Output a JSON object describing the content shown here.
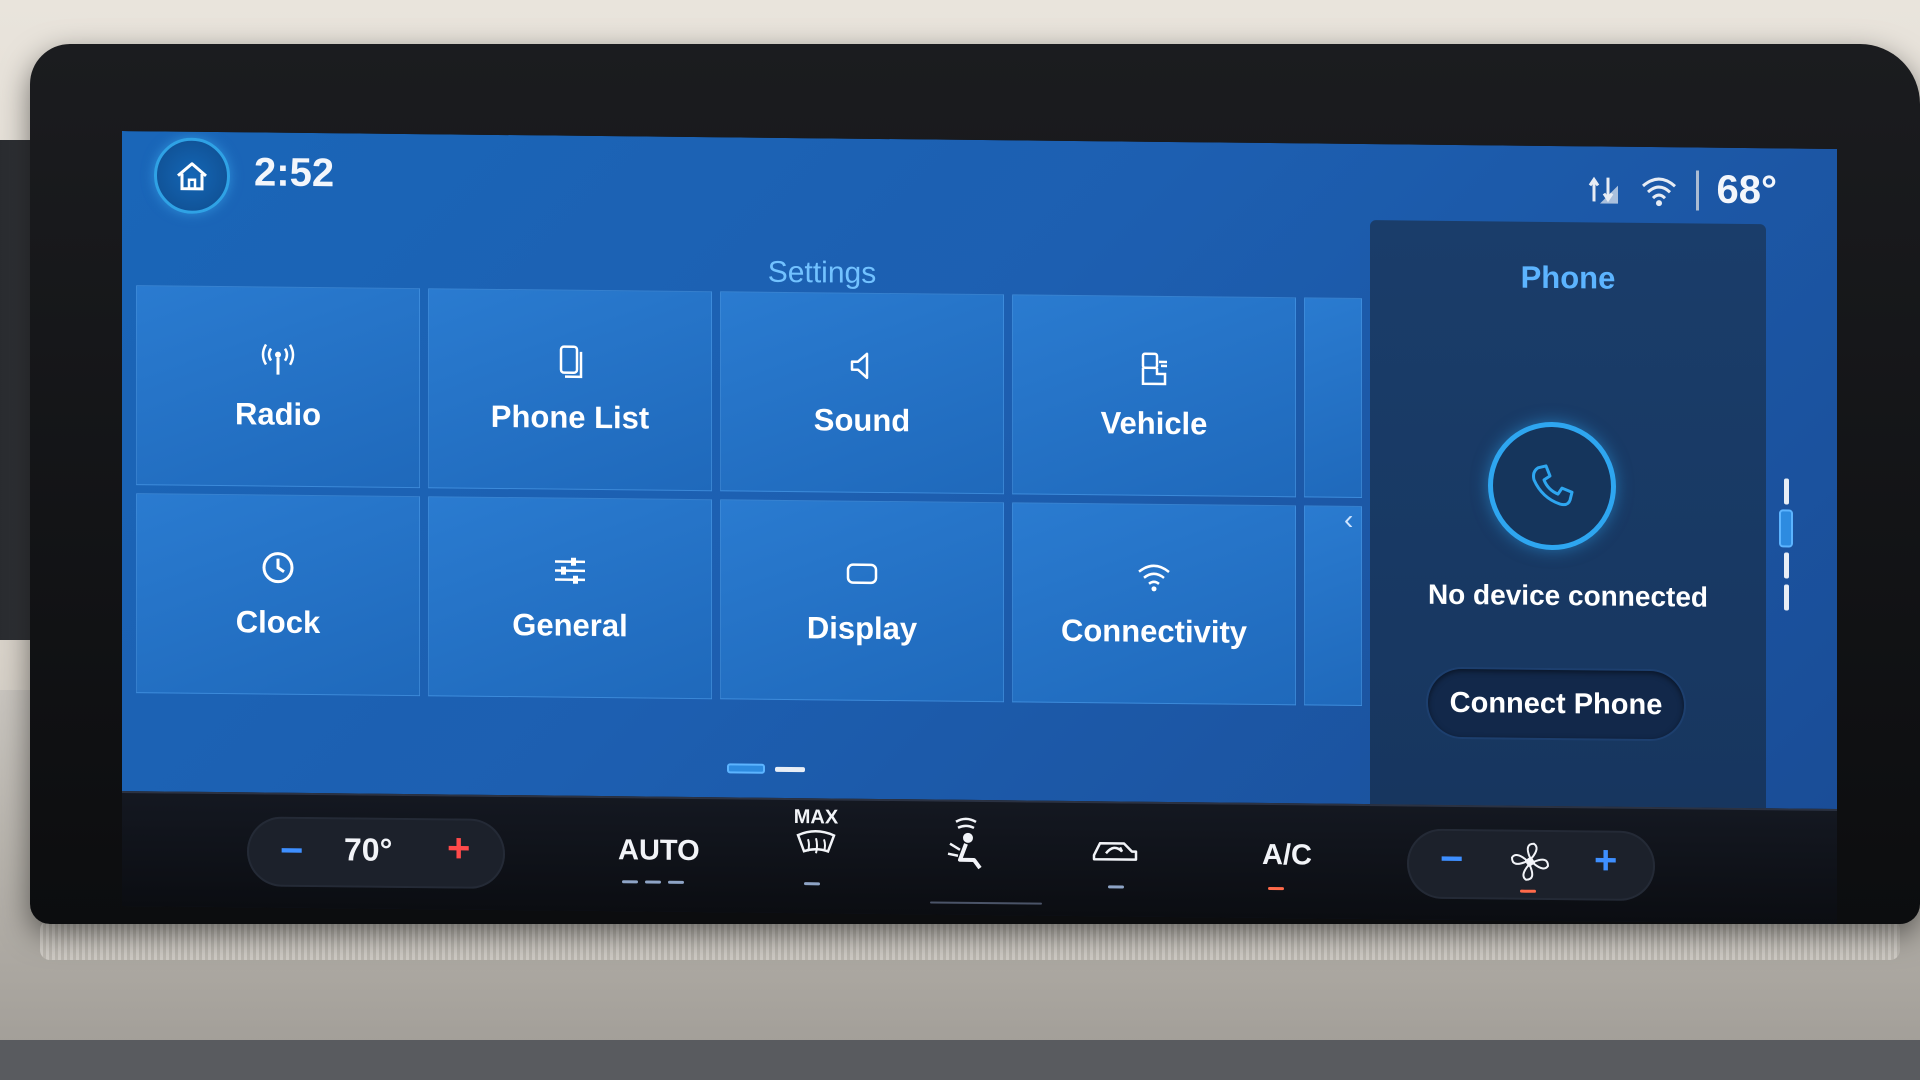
{
  "status_bar": {
    "time": "2:52",
    "outside_temp": "68°"
  },
  "settings": {
    "title": "Settings",
    "tiles": [
      {
        "label": "Radio",
        "icon": "radio-antenna-icon"
      },
      {
        "label": "Phone List",
        "icon": "phone-list-icon"
      },
      {
        "label": "Sound",
        "icon": "speaker-icon"
      },
      {
        "label": "Vehicle",
        "icon": "vehicle-icon"
      },
      {
        "label": "Clock",
        "icon": "clock-icon"
      },
      {
        "label": "General",
        "icon": "sliders-icon"
      },
      {
        "label": "Display",
        "icon": "display-icon"
      },
      {
        "label": "Connectivity",
        "icon": "wifi-icon"
      }
    ]
  },
  "phone_panel": {
    "title": "Phone",
    "status": "No device connected",
    "connect_label": "Connect Phone"
  },
  "climate": {
    "temp_minus": "−",
    "temp_value": "70°",
    "temp_plus": "+",
    "auto_label": "AUTO",
    "max_label": "MAX",
    "ac_label": "A/C",
    "fan_minus": "−",
    "fan_plus": "+"
  },
  "colors": {
    "accent": "#5cb4ff",
    "tile": "#2272c6",
    "panel": "#17365f",
    "warm": "#ff4a4a",
    "cool": "#3e8fff"
  }
}
